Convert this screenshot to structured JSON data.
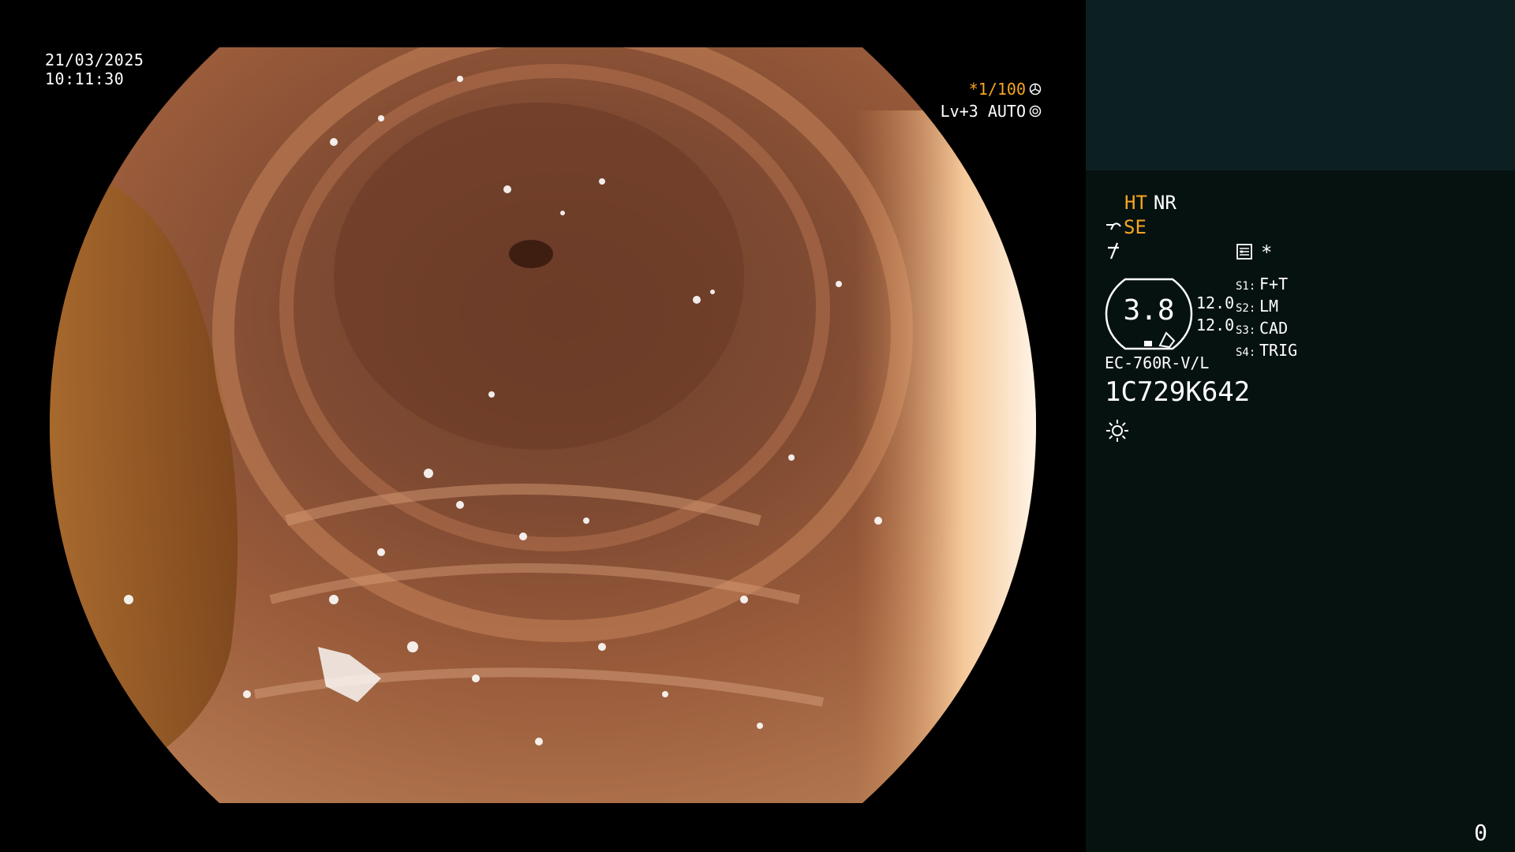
{
  "overlay": {
    "date": "21/03/2025",
    "time": "10:11:30",
    "shutter": "*1/100",
    "level": "Lv+3 AUTO"
  },
  "panel": {
    "ht": "HT",
    "nr": "NR",
    "se": "SE",
    "asterisk": "*",
    "dial_value": "3.8",
    "dial_side_top": "12.0",
    "dial_side_bottom": "12.0",
    "slots": [
      {
        "key": "S1:",
        "value": "F+T"
      },
      {
        "key": "S2:",
        "value": "LM"
      },
      {
        "key": "S3:",
        "value": "CAD"
      },
      {
        "key": "S4:",
        "value": "TRIG"
      }
    ],
    "model": "EC-760R-V/L",
    "serial": "1C729K642"
  },
  "footer": {
    "page": "0"
  },
  "colors": {
    "accent": "#f5a623",
    "panel_top": "#0c2022",
    "panel_main": "#061210"
  }
}
